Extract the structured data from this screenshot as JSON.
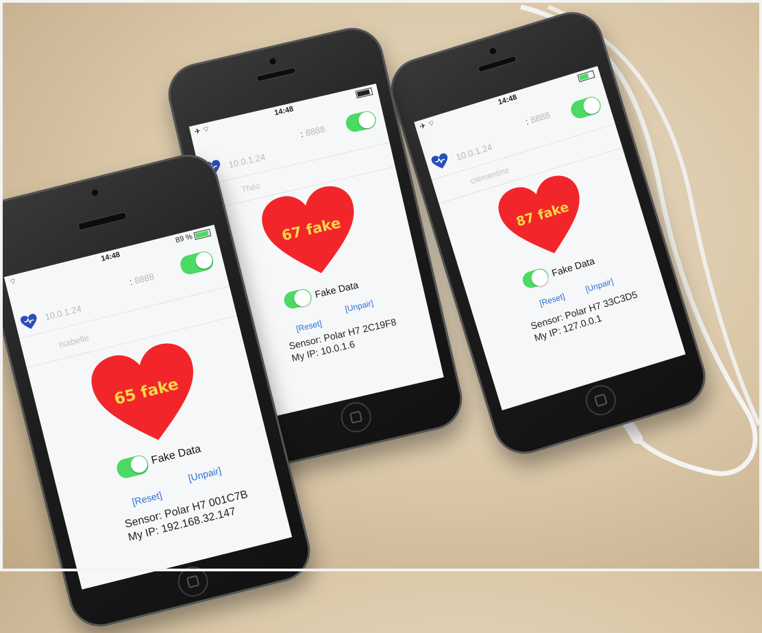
{
  "phones": [
    {
      "time": "14:48",
      "battery": "89 %",
      "host": "10.0.1.24",
      "port": "8888",
      "name": "Isabelle",
      "heart_value": "65 fake",
      "fake_label": "Fake Data",
      "reset": "[Reset]",
      "unpair": "[Unpair]",
      "sensor": "Sensor: Polar H7 001C7B",
      "ip": "My IP: 192.168.32.147"
    },
    {
      "time": "14:48",
      "host": "10.0.1.24",
      "port": "8888",
      "name": "Théo",
      "heart_value": "67 fake",
      "fake_label": "Fake Data",
      "reset": "[Reset]",
      "unpair": "[Unpair]",
      "sensor": "Sensor: Polar H7 2C19F8",
      "ip": "My IP: 10.0.1.6"
    },
    {
      "time": "14:48",
      "host": "10.0.1.24",
      "port": "8888",
      "name": "clémentine",
      "heart_value": "87 fake",
      "fake_label": "Fake Data",
      "reset": "[Reset]",
      "unpair": "[Unpair]",
      "sensor": "Sensor: Polar H7 33C3D5",
      "ip": "My IP: 127.0.0.1"
    }
  ],
  "colors": {
    "heart": "#f2262a",
    "toggle": "#4cd964",
    "link": "#2a6fd8",
    "heart_text": "#f7d64a"
  }
}
